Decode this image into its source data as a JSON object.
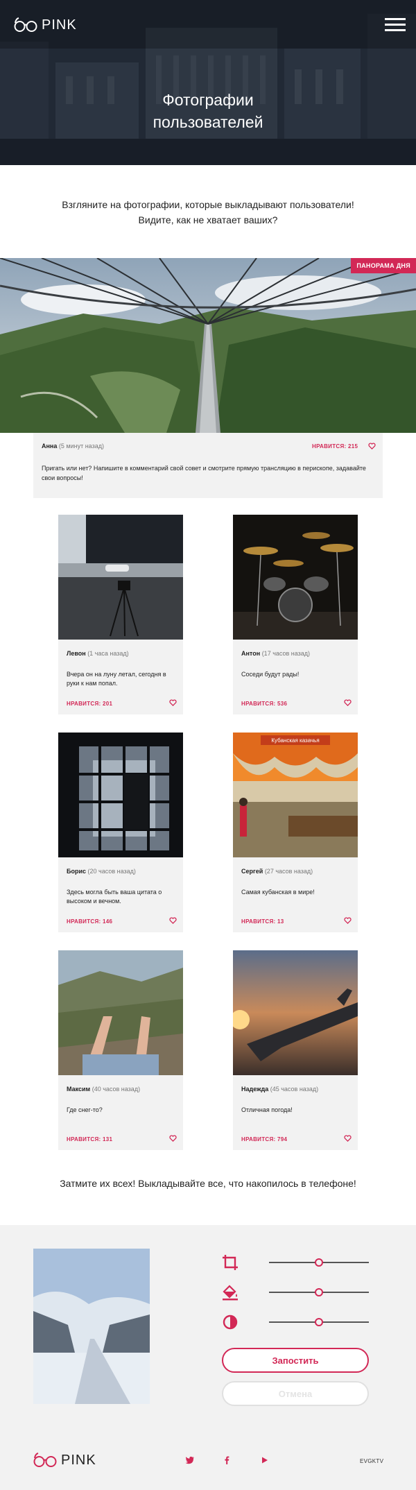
{
  "brand": {
    "logo_text": "PINK"
  },
  "header": {
    "title_line1": "Фотографии",
    "title_line2": "пользователей"
  },
  "intro": {
    "line1": "Взгляните на фотографии, которые выкладывают пользователи!",
    "line2": "Видите, как не хватает ваших?"
  },
  "panorama": {
    "tag": "ПАНОРАМА ДНЯ",
    "author": "Анна",
    "ago": "(5 минут назад)",
    "likes": "НРАВИТСЯ: 215",
    "text": "Пригать или нет? Напишите в комментарий свой совет и смотрите прямую трансляцию в перископе, задавайте свои вопросы!"
  },
  "posts": [
    {
      "author": "Левон",
      "ago": "(1 часа назад)",
      "text": "Вчера он на луну летал, сегодня в руки к нам попал.",
      "likes": "НРАВИТСЯ: 201"
    },
    {
      "author": "Антон",
      "ago": "(17 часов назад)",
      "text": "Соседи будут рады!",
      "likes": "НРАВИТСЯ: 536"
    },
    {
      "author": "Борис",
      "ago": "(20 часов назад)",
      "text": "Здесь могла быть ваша цитата о высоком и вечном.",
      "likes": "НРАВИТСЯ: 146"
    },
    {
      "author": "Сергей",
      "ago": "(27 часов назад)",
      "text": "Самая кубанская в мире!",
      "likes": "НРАВИТСЯ: 13"
    },
    {
      "author": "Максим",
      "ago": "(40 часов назад)",
      "text": "Где снег-то?",
      "likes": "НРАВИТСЯ: 131"
    },
    {
      "author": "Надежда",
      "ago": "(45 часов назад)",
      "text": "Отличная погода!",
      "likes": "НРАВИТСЯ: 794"
    }
  ],
  "market_sign": "Кубанская казачья",
  "cta": {
    "text": "Затмите их всех! Выкладывайте все, что накопилось в телефоне!"
  },
  "editor": {
    "tools": [
      {
        "icon": "crop-icon",
        "value": 0.5
      },
      {
        "icon": "fill-icon",
        "value": 0.5
      },
      {
        "icon": "contrast-icon",
        "value": 0.5
      }
    ],
    "submit_label": "Запостить",
    "cancel_label": "Отмена"
  },
  "footer": {
    "logo_text": "PINK",
    "social": [
      "twitter-icon",
      "facebook-icon",
      "youtube-icon"
    ],
    "credit": "EVGKTV"
  },
  "colors": {
    "accent": "#d22856",
    "panel": "#f2f2f2"
  }
}
